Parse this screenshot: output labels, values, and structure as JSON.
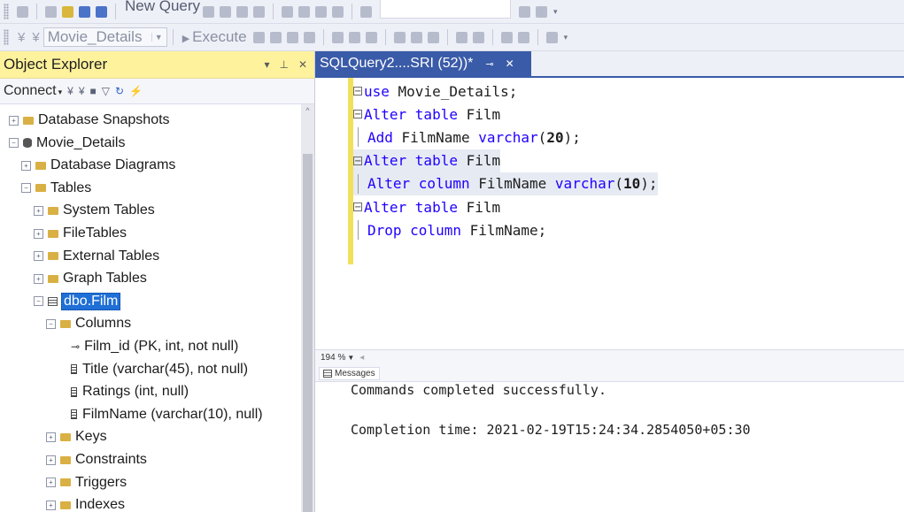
{
  "toolbar_top": {
    "new_query_label": "New Query"
  },
  "toolbar_second": {
    "database_select": "Movie_Details",
    "execute_label": "Execute"
  },
  "object_explorer": {
    "title": "Object Explorer",
    "connect_label": "Connect",
    "tree": [
      {
        "label": "Database Snapshots",
        "indent": 0,
        "icon": "folder-icon",
        "expander": "plus"
      },
      {
        "label": "Movie_Details",
        "indent": 0,
        "icon": "database-icon",
        "expander": "minus"
      },
      {
        "label": "Database Diagrams",
        "indent": 1,
        "icon": "folder-icon",
        "expander": "plus"
      },
      {
        "label": "Tables",
        "indent": 1,
        "icon": "folder-icon",
        "expander": "minus"
      },
      {
        "label": "System Tables",
        "indent": 2,
        "icon": "folder-icon",
        "expander": "plus"
      },
      {
        "label": "FileTables",
        "indent": 2,
        "icon": "folder-icon",
        "expander": "plus"
      },
      {
        "label": "External Tables",
        "indent": 2,
        "icon": "folder-icon",
        "expander": "plus"
      },
      {
        "label": "Graph Tables",
        "indent": 2,
        "icon": "folder-icon",
        "expander": "plus"
      },
      {
        "label": "dbo.Film",
        "indent": 2,
        "icon": "table-icon",
        "expander": "minus",
        "selected": true
      },
      {
        "label": "Columns",
        "indent": 3,
        "icon": "folder-icon",
        "expander": "minus"
      },
      {
        "label": "Film_id (PK, int, not null)",
        "indent": 4,
        "icon": "primary-key-icon",
        "expander": "none"
      },
      {
        "label": "Title (varchar(45), not null)",
        "indent": 4,
        "icon": "column-icon",
        "expander": "none"
      },
      {
        "label": "Ratings (int, null)",
        "indent": 4,
        "icon": "column-icon",
        "expander": "none"
      },
      {
        "label": "FilmName (varchar(10), null)",
        "indent": 4,
        "icon": "column-icon",
        "expander": "none"
      },
      {
        "label": "Keys",
        "indent": 3,
        "icon": "folder-icon",
        "expander": "plus"
      },
      {
        "label": "Constraints",
        "indent": 3,
        "icon": "folder-icon",
        "expander": "plus"
      },
      {
        "label": "Triggers",
        "indent": 3,
        "icon": "folder-icon",
        "expander": "plus"
      },
      {
        "label": "Indexes",
        "indent": 3,
        "icon": "folder-icon",
        "expander": "plus"
      }
    ]
  },
  "editor": {
    "tab_title": "SQLQuery2....SRI (52))*",
    "lines": [
      {
        "fold": "start",
        "tokens": [
          {
            "t": "use",
            "k": "kw"
          },
          {
            "t": " Movie_Details;",
            "k": ""
          }
        ]
      },
      {
        "fold": "start",
        "tokens": [
          {
            "t": "Alter table",
            "k": "kw"
          },
          {
            "t": " Film",
            "k": ""
          }
        ]
      },
      {
        "fold": "inner",
        "tokens": [
          {
            "t": "Add",
            "k": "kw"
          },
          {
            "t": " FilmName ",
            "k": ""
          },
          {
            "t": "varchar",
            "k": "kw"
          },
          {
            "t": "(",
            "k": ""
          },
          {
            "t": "20",
            "k": "num"
          },
          {
            "t": ");",
            "k": ""
          }
        ]
      },
      {
        "fold": "start",
        "highlight": true,
        "tokens": [
          {
            "t": "Alter table",
            "k": "kw"
          },
          {
            "t": " Film",
            "k": ""
          }
        ]
      },
      {
        "fold": "inner",
        "highlight": true,
        "tokens": [
          {
            "t": "Alter column",
            "k": "kw"
          },
          {
            "t": " FilmName ",
            "k": ""
          },
          {
            "t": "varchar",
            "k": "kw"
          },
          {
            "t": "(",
            "k": ""
          },
          {
            "t": "10",
            "k": "num"
          },
          {
            "t": ");",
            "k": ""
          }
        ]
      },
      {
        "fold": "start",
        "tokens": [
          {
            "t": "Alter table",
            "k": "kw"
          },
          {
            "t": " Film",
            "k": ""
          }
        ]
      },
      {
        "fold": "inner",
        "tokens": [
          {
            "t": "Drop column",
            "k": "kw"
          },
          {
            "t": " FilmName;",
            "k": ""
          }
        ]
      }
    ],
    "zoom": "194 %"
  },
  "results": {
    "tab_label": "Messages",
    "lines": [
      "Commands completed successfully.",
      "Completion time: 2021-02-19T15:24:34.2854050+05:30"
    ]
  },
  "colors": {
    "accent": "#3a5ba8",
    "keyword": "#1f00ff",
    "selection": "#1f6fd6",
    "explorer_header": "#fff29d"
  }
}
